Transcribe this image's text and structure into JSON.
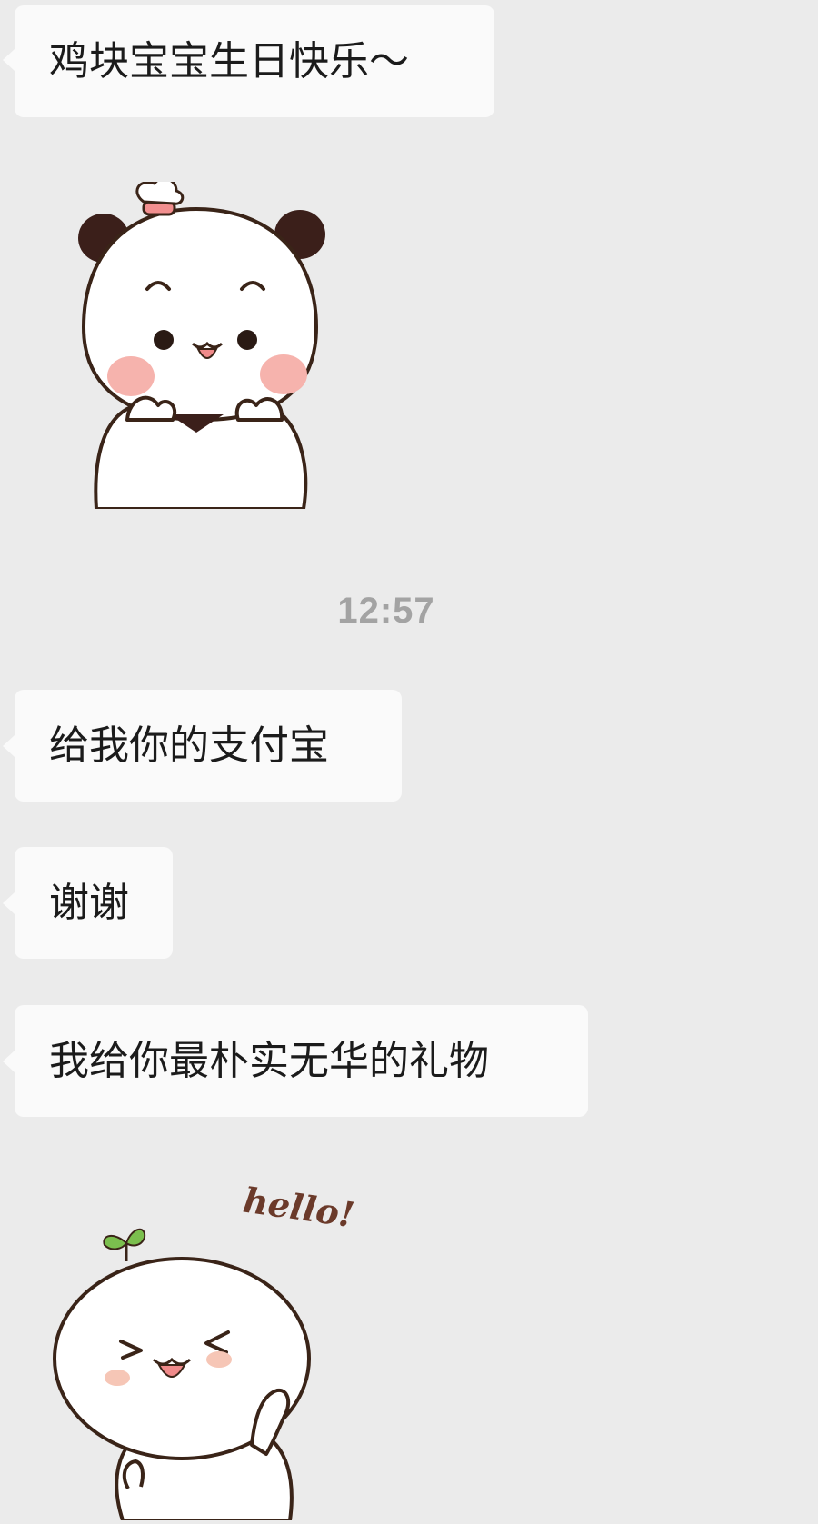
{
  "messages": [
    {
      "type": "text",
      "text": "鸡块宝宝生日快乐～"
    },
    {
      "type": "sticker",
      "name": "panda-sticker"
    },
    {
      "type": "timestamp",
      "text": "12:57"
    },
    {
      "type": "text",
      "text": "给我你的支付宝"
    },
    {
      "type": "text",
      "text": "谢谢"
    },
    {
      "type": "text",
      "text": "我给你最朴实无华的礼物"
    },
    {
      "type": "sticker",
      "name": "sprout-hello-sticker",
      "caption": "hello!"
    }
  ],
  "colors": {
    "background": "#ebebeb",
    "bubble": "#fafafa",
    "text": "#1b1b1b",
    "timestamp": "#a3a3a3",
    "outline": "#3a2418",
    "cheek": "#f6b3ad",
    "leaf": "#7bbf4e",
    "hello_text": "#6b3a2a"
  }
}
